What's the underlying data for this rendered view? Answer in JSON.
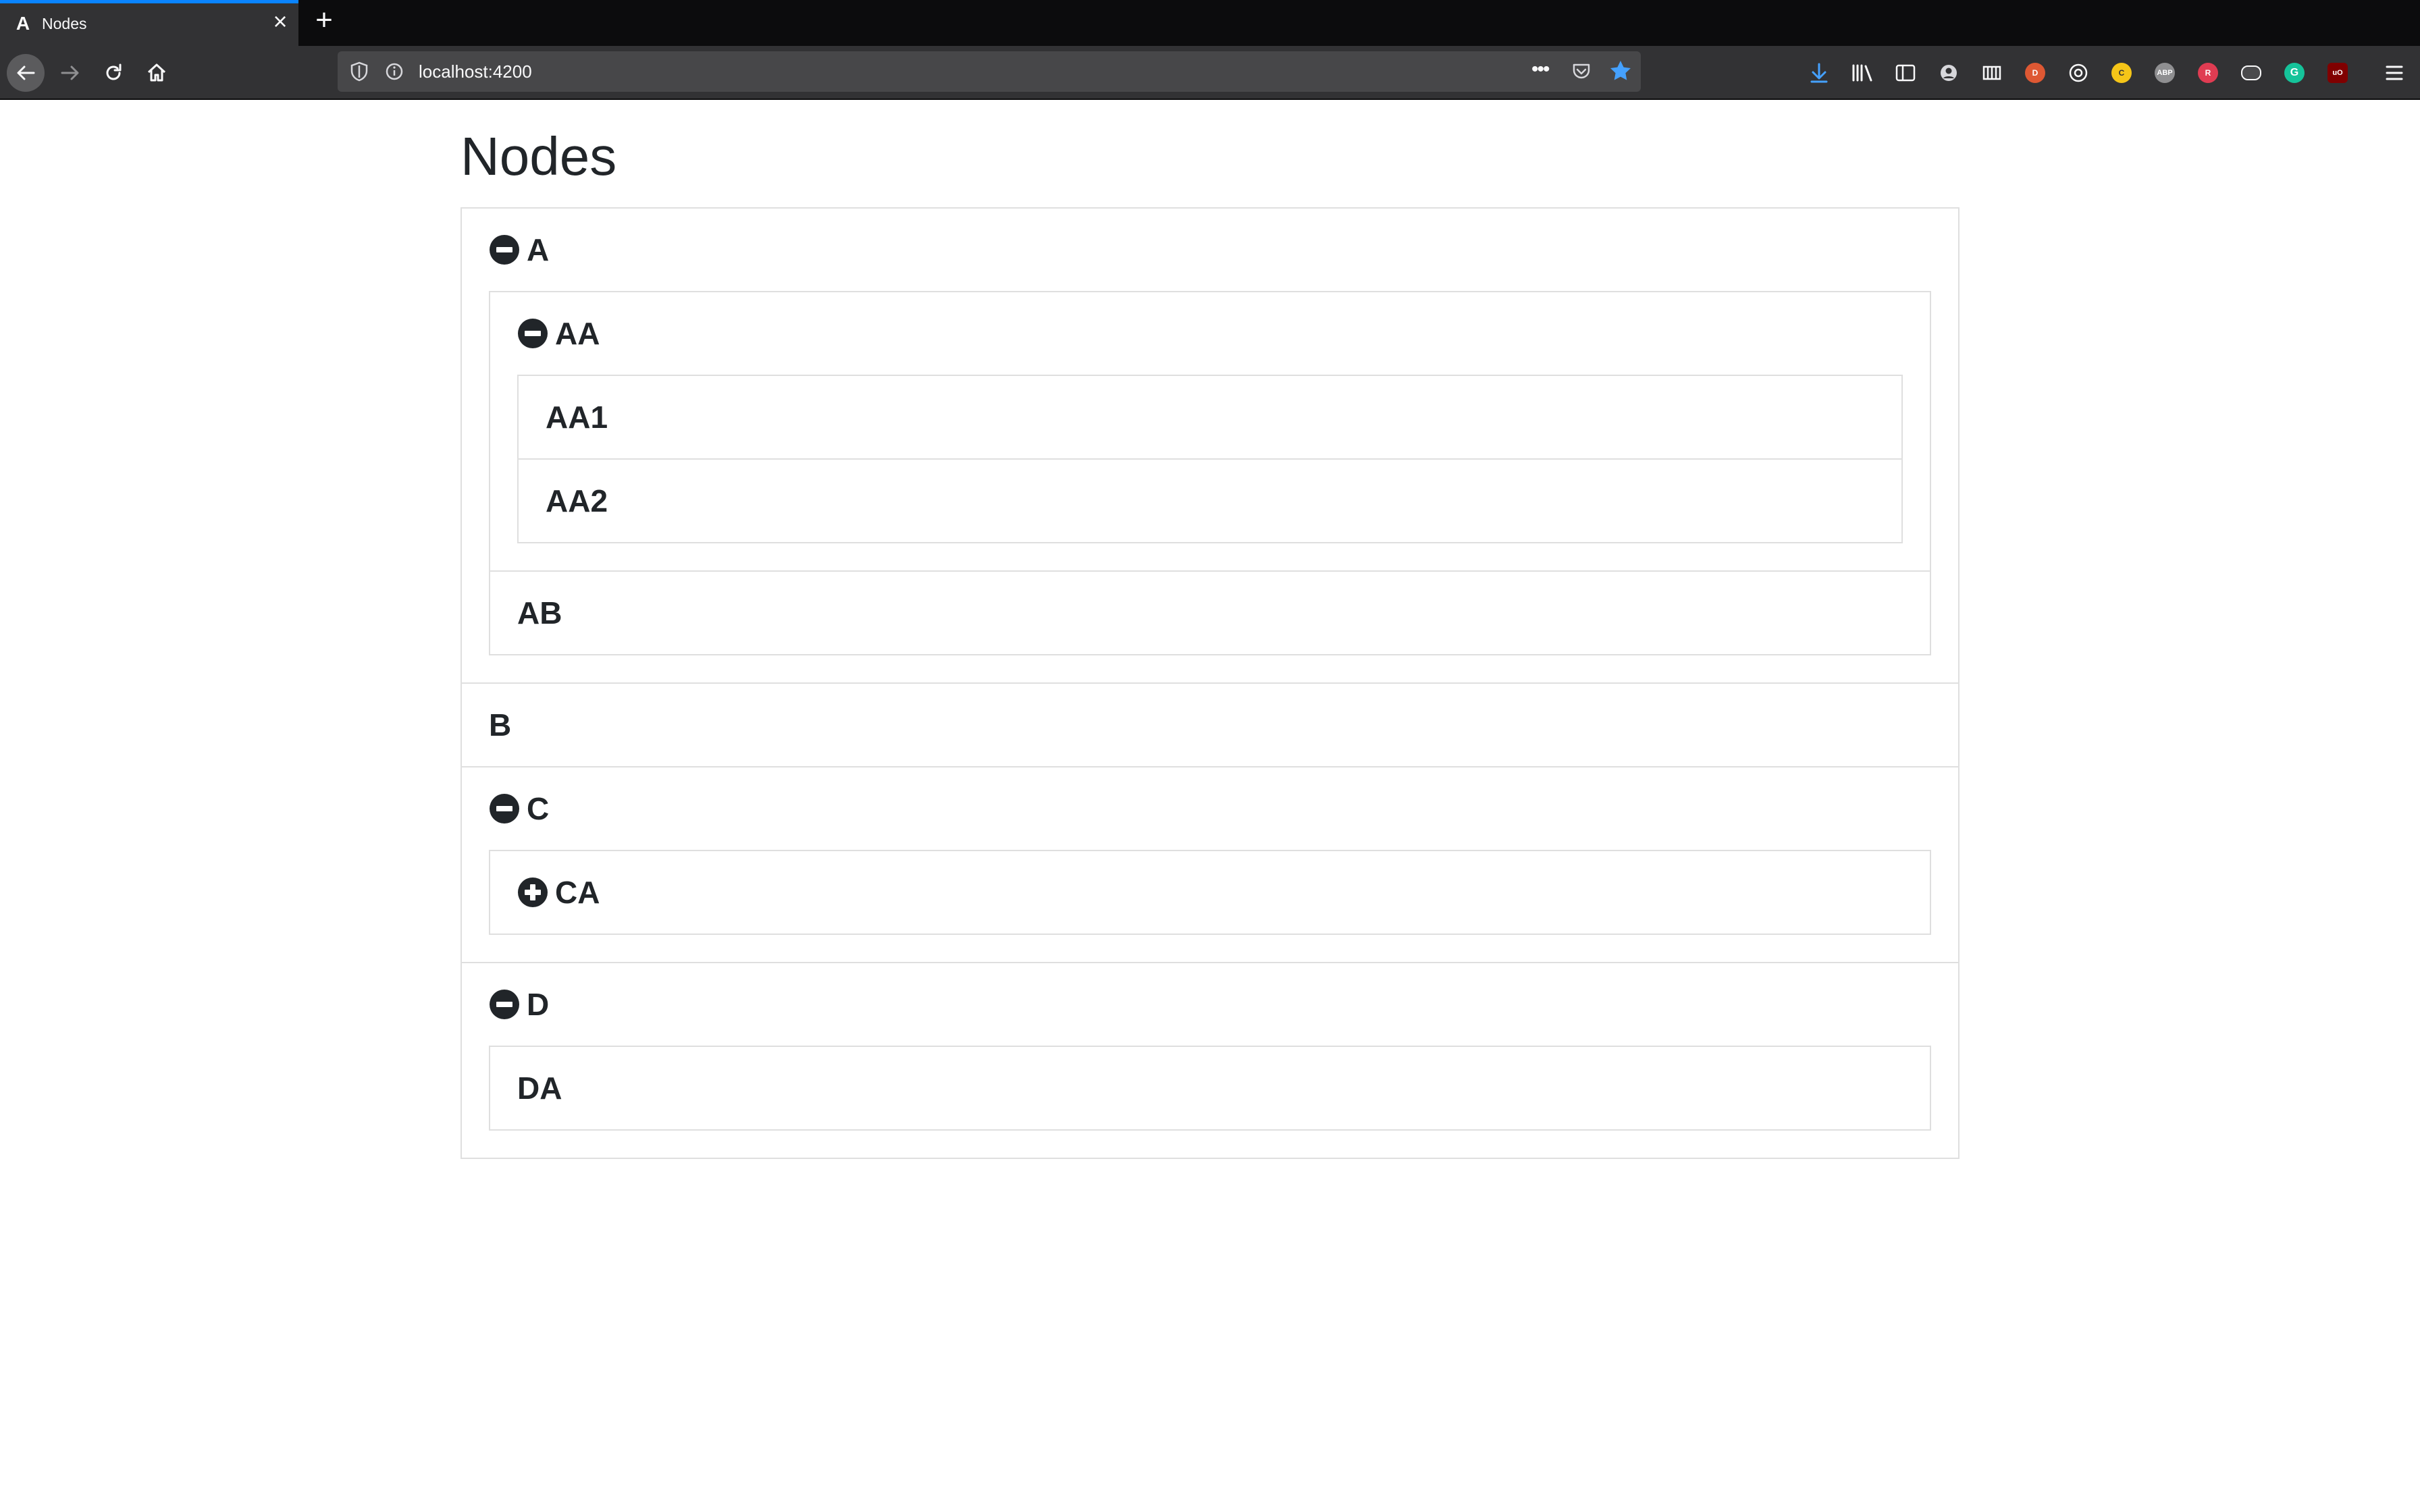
{
  "browser": {
    "tab_title": "Nodes",
    "tab_favicon": "A",
    "url": "localhost:4200",
    "more_glyph": "•••"
  },
  "page": {
    "title": "Nodes"
  },
  "tree": {
    "A": "A",
    "AA": "AA",
    "AA1": "AA1",
    "AA2": "AA2",
    "AB": "AB",
    "B": "B",
    "C": "C",
    "CA": "CA",
    "D": "D",
    "DA": "DA"
  },
  "icons": {
    "expanded": "minus-circle-icon",
    "collapsed": "plus-circle-icon"
  },
  "colors": {
    "accent": "#0a84ff",
    "text": "#212529",
    "border": "#dfdfdf"
  }
}
